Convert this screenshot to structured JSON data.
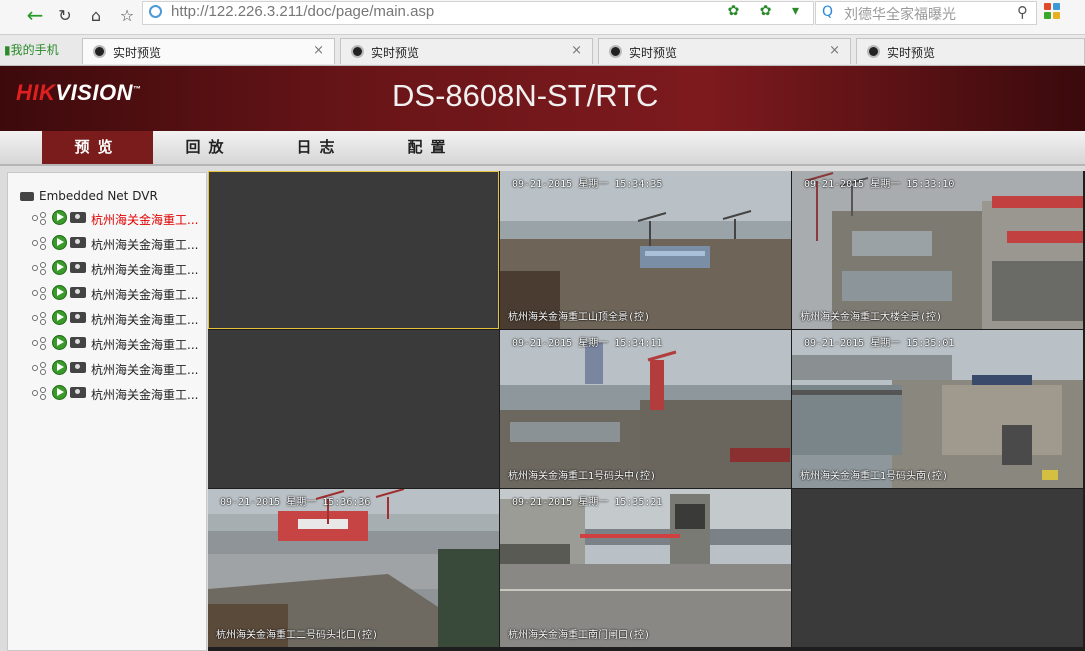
{
  "browser": {
    "url": "http://122.226.3.211/doc/page/main.asp",
    "search_placeholder": "刘德华全家福曝光",
    "favorite_label": "我的手机",
    "tabs": [
      {
        "label": "实时预览",
        "active": true,
        "closable": true
      },
      {
        "label": "实时预览",
        "active": false,
        "closable": true
      },
      {
        "label": "实时预览",
        "active": false,
        "closable": true
      },
      {
        "label": "实时预览",
        "active": false,
        "closable": false
      }
    ],
    "close_glyph": "×"
  },
  "header": {
    "logo_red": "HIK",
    "logo_white": "VISION",
    "logo_tm": "™",
    "model": "DS-8608N-ST/RTC"
  },
  "nav": {
    "items": [
      {
        "label": "预览",
        "active": true
      },
      {
        "label": "回放",
        "active": false
      },
      {
        "label": "日志",
        "active": false
      },
      {
        "label": "配置",
        "active": false
      }
    ]
  },
  "sidebar": {
    "root_label": "Embedded Net DVR",
    "cameras": [
      {
        "label": "杭州海关金海重工...",
        "selected": true
      },
      {
        "label": "杭州海关金海重工...",
        "selected": false
      },
      {
        "label": "杭州海关金海重工...",
        "selected": false
      },
      {
        "label": "杭州海关金海重工...",
        "selected": false
      },
      {
        "label": "杭州海关金海重工...",
        "selected": false
      },
      {
        "label": "杭州海关金海重工...",
        "selected": false
      },
      {
        "label": "杭州海关金海重工...",
        "selected": false
      },
      {
        "label": "杭州海关金海重工...",
        "selected": false
      }
    ]
  },
  "video_grid": {
    "cells": [
      {
        "empty": true,
        "selected": true
      },
      {
        "empty": false,
        "timestamp": "09-21-2015 星期一 15:34:35",
        "name": "杭州海关金海重工山顶全景(控)"
      },
      {
        "empty": false,
        "timestamp": "09-21-2015 星期一 15:33:10",
        "name": "杭州海关金海重工大楼全景(控)"
      },
      {
        "empty": true,
        "selected": false
      },
      {
        "empty": false,
        "timestamp": "09-21-2015 星期一 15:34:11",
        "name": "杭州海关金海重工1号码头中(控)"
      },
      {
        "empty": false,
        "timestamp": "09-21-2015 星期一 15:35:01",
        "name": "杭州海关金海重工1号码头南(控)"
      },
      {
        "empty": false,
        "timestamp": "09-21-2015 星期一 15:36:36",
        "name": "杭州海关金海重工二号码头北口(控)"
      },
      {
        "empty": false,
        "timestamp": "09-21-2015 星期一 15:35:21",
        "name": "杭州海关金海重工南门闸口(控)"
      },
      {
        "empty": true,
        "selected": false
      }
    ]
  },
  "colors": {
    "brand_red": "#7a1c1c",
    "selected_text": "#e00000",
    "selection_border": "#e6c23a"
  }
}
